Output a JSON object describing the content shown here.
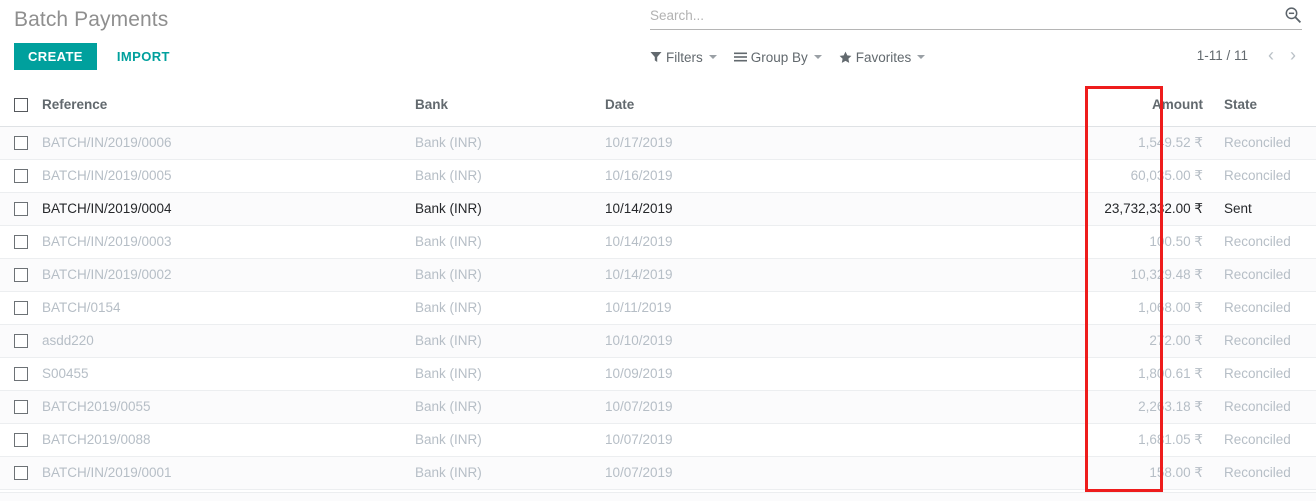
{
  "page": {
    "title": "Batch Payments"
  },
  "actions": {
    "create_label": "CREATE",
    "import_label": "IMPORT"
  },
  "search": {
    "placeholder": "Search...",
    "value": "",
    "icon": "search-icon"
  },
  "filter_bar": {
    "filters_label": "Filters",
    "group_by_label": "Group By",
    "favorites_label": "Favorites",
    "filters_icon": "funnel-icon",
    "group_by_icon": "bars-icon",
    "favorites_icon": "star-icon"
  },
  "pager": {
    "range": "1-11 / 11",
    "prev_icon": "chevron-left-icon",
    "next_icon": "chevron-right-icon"
  },
  "table": {
    "columns": [
      {
        "key": "reference",
        "label": "Reference"
      },
      {
        "key": "bank",
        "label": "Bank"
      },
      {
        "key": "date",
        "label": "Date"
      },
      {
        "key": "amount",
        "label": "Amount"
      },
      {
        "key": "state",
        "label": "State"
      }
    ],
    "rows": [
      {
        "reference": "BATCH/IN/2019/0006",
        "bank": "Bank (INR)",
        "date": "10/17/2019",
        "amount": "1,549.52 ₹",
        "state": "Reconciled",
        "highlighted": false
      },
      {
        "reference": "BATCH/IN/2019/0005",
        "bank": "Bank (INR)",
        "date": "10/16/2019",
        "amount": "60,035.00 ₹",
        "state": "Reconciled",
        "highlighted": false
      },
      {
        "reference": "BATCH/IN/2019/0004",
        "bank": "Bank (INR)",
        "date": "10/14/2019",
        "amount": "23,732,332.00 ₹",
        "state": "Sent",
        "highlighted": true
      },
      {
        "reference": "BATCH/IN/2019/0003",
        "bank": "Bank (INR)",
        "date": "10/14/2019",
        "amount": "100.50 ₹",
        "state": "Reconciled",
        "highlighted": false
      },
      {
        "reference": "BATCH/IN/2019/0002",
        "bank": "Bank (INR)",
        "date": "10/14/2019",
        "amount": "10,329.48 ₹",
        "state": "Reconciled",
        "highlighted": false
      },
      {
        "reference": "BATCH/0154",
        "bank": "Bank (INR)",
        "date": "10/11/2019",
        "amount": "1,068.00 ₹",
        "state": "Reconciled",
        "highlighted": false
      },
      {
        "reference": "asdd220",
        "bank": "Bank (INR)",
        "date": "10/10/2019",
        "amount": "272.00 ₹",
        "state": "Reconciled",
        "highlighted": false
      },
      {
        "reference": "S00455",
        "bank": "Bank (INR)",
        "date": "10/09/2019",
        "amount": "1,800.61 ₹",
        "state": "Reconciled",
        "highlighted": false
      },
      {
        "reference": "BATCH2019/0055",
        "bank": "Bank (INR)",
        "date": "10/07/2019",
        "amount": "2,263.18 ₹",
        "state": "Reconciled",
        "highlighted": false
      },
      {
        "reference": "BATCH2019/0088",
        "bank": "Bank (INR)",
        "date": "10/07/2019",
        "amount": "1,681.05 ₹",
        "state": "Reconciled",
        "highlighted": false
      },
      {
        "reference": "BATCH/IN/2019/0001",
        "bank": "Bank (INR)",
        "date": "10/07/2019",
        "amount": "158.00 ₹",
        "state": "Reconciled",
        "highlighted": false
      }
    ]
  },
  "annotation": {
    "highlight_color": "#ee1c1c",
    "highlight_target": "state-column"
  },
  "colors": {
    "accent": "#00a09d",
    "title": "#8f8f8f",
    "muted_text": "#b6bec6",
    "header_text": "#62696e"
  }
}
